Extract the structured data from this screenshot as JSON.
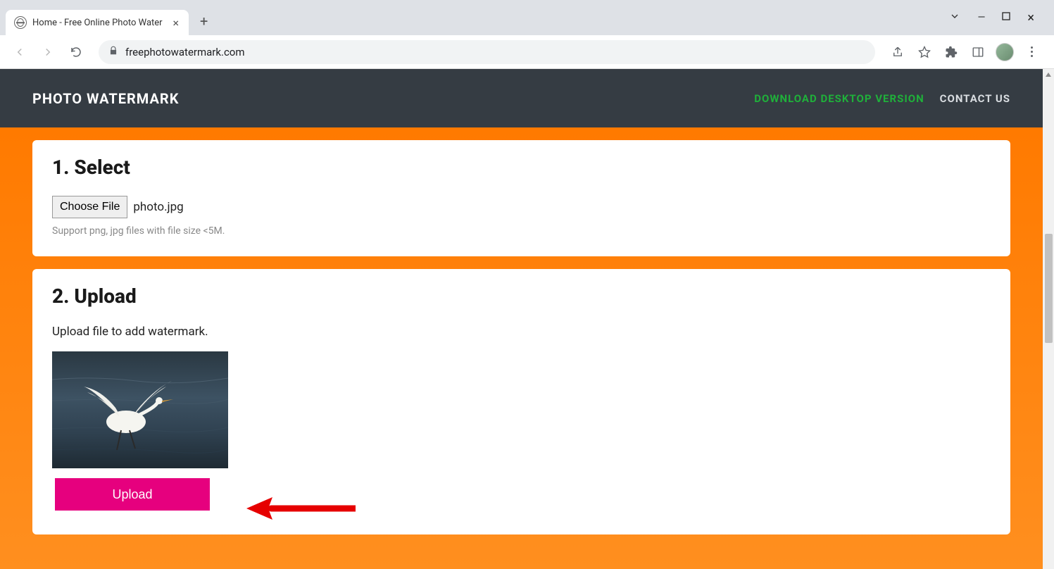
{
  "browser": {
    "tab_title": "Home - Free Online Photo Water",
    "url": "freephotowatermark.com"
  },
  "header": {
    "brand": "PHOTO WATERMARK",
    "nav_download": "DOWNLOAD DESKTOP VERSION",
    "nav_contact": "CONTACT US"
  },
  "step1": {
    "title": "1. Select",
    "choose_label": "Choose File",
    "filename": "photo.jpg",
    "support": "Support png, jpg files with file size <5M."
  },
  "step2": {
    "title": "2. Upload",
    "hint": "Upload file to add watermark.",
    "button": "Upload"
  }
}
